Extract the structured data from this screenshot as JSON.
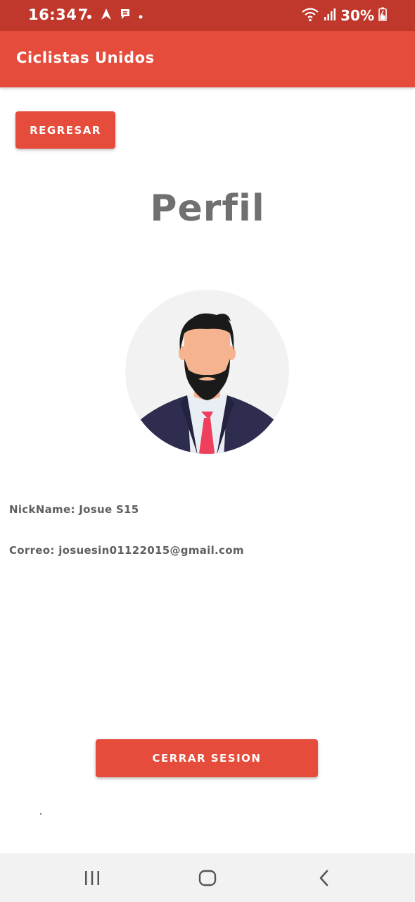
{
  "status_bar": {
    "time": "16:34",
    "battery": "30%",
    "icons": [
      "percent-notification-icon",
      "arrow-notification-icon",
      "message-notification-icon",
      "dot-icon",
      "wifi-icon",
      "signal-icon",
      "battery-charging-icon"
    ]
  },
  "app_bar": {
    "title": "Ciclistas Unidos"
  },
  "buttons": {
    "back_label": "REGRESAR",
    "logout_label": "CERRAR SESION"
  },
  "profile": {
    "title": "Perfil",
    "avatar_icon": "man-avatar-illustration",
    "nickname_line": "NickName: Josue S15",
    "email_line": "Correo: josuesin01122015@gmail.com"
  },
  "navigation": {
    "items": [
      "recents-icon",
      "home-icon",
      "back-icon"
    ]
  },
  "colors": {
    "status_bar": "#c0372b",
    "primary": "#e64c3c",
    "title_text": "#707070",
    "body_text": "#5f5f5f",
    "nav_bar": "#f2f2f2"
  }
}
